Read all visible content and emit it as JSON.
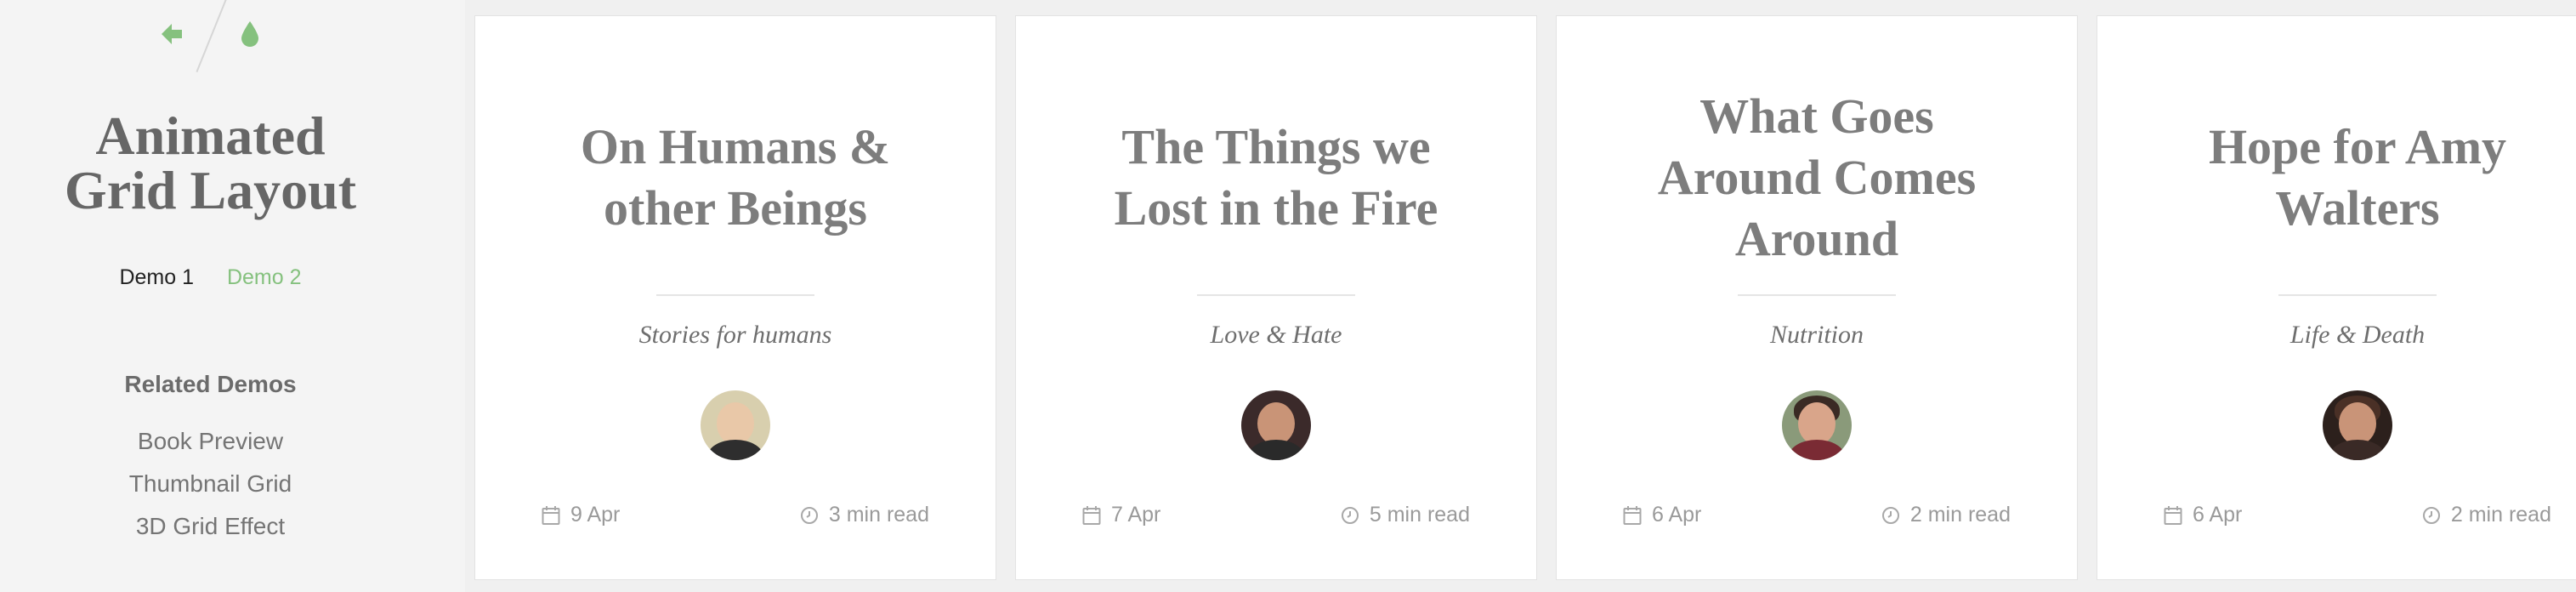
{
  "sidebar": {
    "nav": {
      "back_icon": "arrow-left-icon",
      "drop_icon": "droplet-icon",
      "accent": "#85c17e"
    },
    "title_line1": "Animated",
    "title_line2": "Grid Layout",
    "demos": {
      "current": "Demo 1",
      "other": "Demo 2"
    },
    "related_heading": "Related Demos",
    "related": [
      "Book Preview",
      "Thumbnail Grid",
      "3D Grid Effect"
    ]
  },
  "cards": [
    {
      "title_lines": [
        "On Humans &",
        "other Beings"
      ],
      "category": "Stories for humans",
      "date": "9 Apr",
      "read": "3 min read"
    },
    {
      "title_lines": [
        "The Things we",
        "Lost in the Fire"
      ],
      "category": "Love & Hate",
      "date": "7 Apr",
      "read": "5 min read"
    },
    {
      "title_lines": [
        "What Goes",
        "Around Comes",
        "Around"
      ],
      "category": "Nutrition",
      "date": "6 Apr",
      "read": "2 min read"
    },
    {
      "title_lines": [
        "Hope for Amy",
        "Walters"
      ],
      "category": "Life & Death",
      "date": "6 Apr",
      "read": "2 min read"
    }
  ]
}
